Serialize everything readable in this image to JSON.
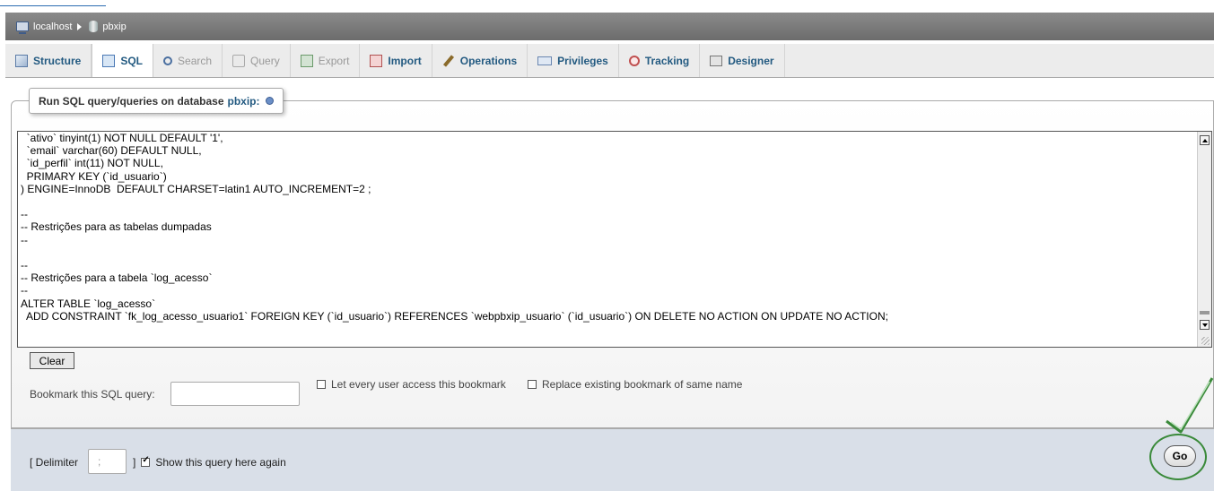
{
  "breadcrumb": {
    "server": "localhost",
    "database": "pbxip"
  },
  "tabs": [
    {
      "label": "Structure",
      "icon": "structure-icon",
      "state": "enabled"
    },
    {
      "label": "SQL",
      "icon": "sql-icon",
      "state": "active"
    },
    {
      "label": "Search",
      "icon": "search-icon",
      "state": "disabled"
    },
    {
      "label": "Query",
      "icon": "query-icon",
      "state": "disabled"
    },
    {
      "label": "Export",
      "icon": "export-icon",
      "state": "disabled"
    },
    {
      "label": "Import",
      "icon": "import-icon",
      "state": "enabled"
    },
    {
      "label": "Operations",
      "icon": "operations-icon",
      "state": "enabled"
    },
    {
      "label": "Privileges",
      "icon": "privileges-icon",
      "state": "enabled"
    },
    {
      "label": "Tracking",
      "icon": "tracking-icon",
      "state": "enabled"
    },
    {
      "label": "Designer",
      "icon": "designer-icon",
      "state": "enabled"
    }
  ],
  "legend": {
    "prefix": "Run SQL query/queries on database",
    "database": "pbxip:"
  },
  "sql_query": "  `ativo` tinyint(1) NOT NULL DEFAULT '1',\n  `email` varchar(60) DEFAULT NULL,\n  `id_perfil` int(11) NOT NULL,\n  PRIMARY KEY (`id_usuario`)\n) ENGINE=InnoDB  DEFAULT CHARSET=latin1 AUTO_INCREMENT=2 ;\n\n--\n-- Restrições para as tabelas dumpadas\n--\n\n--\n-- Restrições para a tabela `log_acesso`\n--\nALTER TABLE `log_acesso`\n  ADD CONSTRAINT `fk_log_acesso_usuario1` FOREIGN KEY (`id_usuario`) REFERENCES `webpbxip_usuario` (`id_usuario`) ON DELETE NO ACTION ON UPDATE NO ACTION;",
  "buttons": {
    "clear": "Clear",
    "go": "Go"
  },
  "bookmark": {
    "label": "Bookmark this SQL query:",
    "value": "",
    "option_every_user": "Let every user access this bookmark",
    "option_every_user_checked": false,
    "option_replace": "Replace existing bookmark of same name",
    "option_replace_checked": false
  },
  "footer": {
    "delimiter_open": "[ Delimiter",
    "delimiter_value": ";",
    "delimiter_close": "]",
    "show_again_label": "Show this query here again",
    "show_again_checked": true
  },
  "colors": {
    "link": "#235a81",
    "annotation": "#3a8a3a"
  }
}
